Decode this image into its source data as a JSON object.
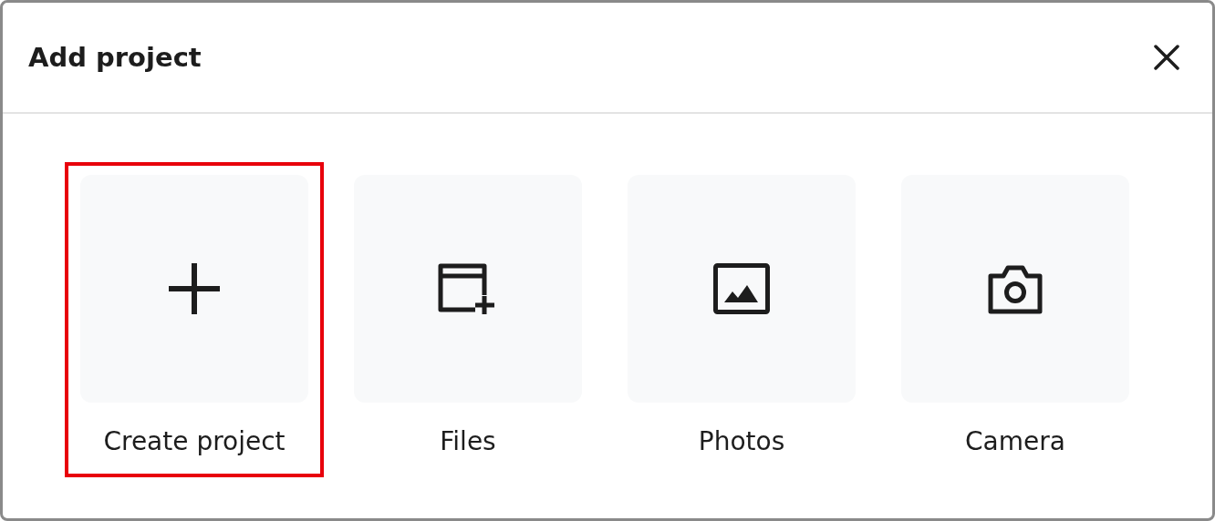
{
  "dialog": {
    "title": "Add project"
  },
  "options": [
    {
      "kind": "create",
      "label": "Create project",
      "selected": true
    },
    {
      "kind": "files",
      "label": "Files",
      "selected": false
    },
    {
      "kind": "photos",
      "label": "Photos",
      "selected": false
    },
    {
      "kind": "camera",
      "label": "Camera",
      "selected": false
    }
  ]
}
